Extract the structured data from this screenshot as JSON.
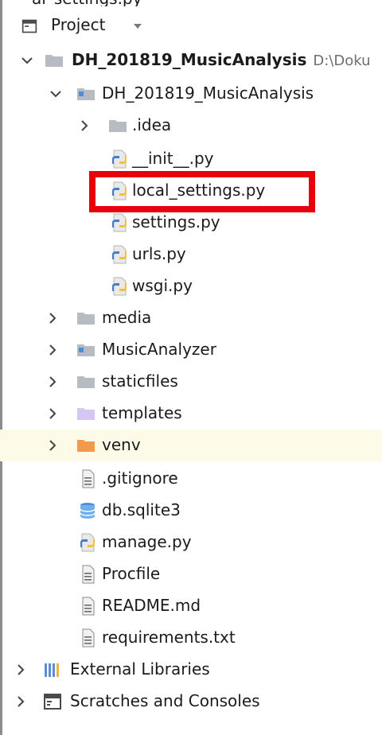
{
  "top_cut_text": "al_settings.py",
  "header": {
    "label": "Project"
  },
  "tree": {
    "root": {
      "label": "DH_201819_MusicAnalysis",
      "path": "D:\\Doku"
    },
    "pkg": {
      "label": "DH_201819_MusicAnalysis"
    },
    "idea": {
      "label": ".idea"
    },
    "init": {
      "label": "__init__.py"
    },
    "local_settings": {
      "label": "local_settings.py"
    },
    "settings": {
      "label": "settings.py"
    },
    "urls": {
      "label": "urls.py"
    },
    "wsgi": {
      "label": "wsgi.py"
    },
    "media": {
      "label": "media"
    },
    "musicanalyzer": {
      "label": "MusicAnalyzer"
    },
    "staticfiles": {
      "label": "staticfiles"
    },
    "templates": {
      "label": "templates"
    },
    "venv": {
      "label": "venv"
    },
    "gitignore": {
      "label": ".gitignore"
    },
    "db": {
      "label": "db.sqlite3"
    },
    "manage": {
      "label": "manage.py"
    },
    "procfile": {
      "label": "Procfile"
    },
    "readme": {
      "label": "README.md"
    },
    "requirements": {
      "label": "requirements.txt"
    },
    "external": {
      "label": "External Libraries"
    },
    "scratches": {
      "label": "Scratches and Consoles"
    }
  },
  "colors": {
    "highlight_box": "#e8000b",
    "venv_row_bg": "#fdfbe8",
    "folder_gray": "#b8bcc2",
    "folder_purple": "#d6c6f3",
    "folder_orange": "#f29a4a",
    "python_blue": "#3f7fc8",
    "python_yellow": "#f1c232"
  }
}
